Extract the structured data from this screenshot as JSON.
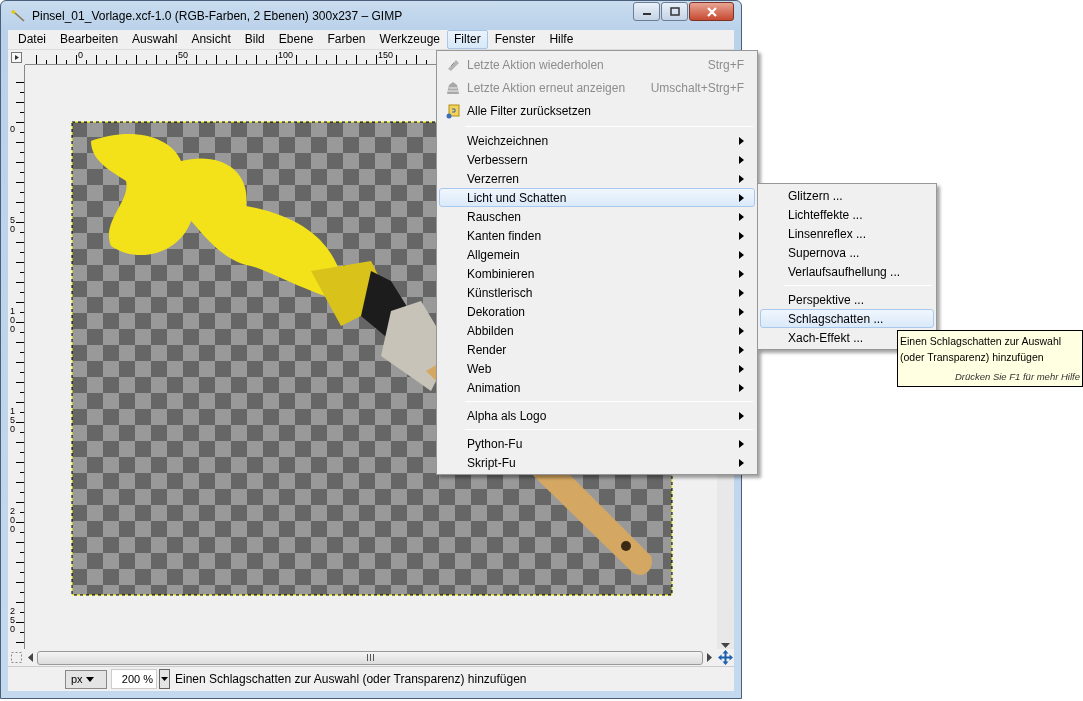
{
  "window": {
    "title": "Pinsel_01_Vorlage.xcf-1.0 (RGB-Farben, 2 Ebenen) 300x237 – GIMP"
  },
  "menubar": [
    {
      "label": "Datei",
      "selected": false
    },
    {
      "label": "Bearbeiten",
      "selected": false
    },
    {
      "label": "Auswahl",
      "selected": false
    },
    {
      "label": "Ansicht",
      "selected": false
    },
    {
      "label": "Bild",
      "selected": false
    },
    {
      "label": "Ebene",
      "selected": false
    },
    {
      "label": "Farben",
      "selected": false
    },
    {
      "label": "Werkzeuge",
      "selected": false
    },
    {
      "label": "Filter",
      "selected": true
    },
    {
      "label": "Fenster",
      "selected": false
    },
    {
      "label": "Hilfe",
      "selected": false
    }
  ],
  "rulers": {
    "horizontal": [
      "0",
      "50",
      "100",
      "150"
    ],
    "vertical": [
      "0",
      "50",
      "100",
      "150",
      "200",
      "250"
    ]
  },
  "filter_menu": {
    "items": [
      {
        "kind": "action",
        "label": "Letzte Aktion wiederholen",
        "shortcut": "Strg+F",
        "disabled": true
      },
      {
        "kind": "action",
        "label": "Letzte Aktion erneut anzeigen",
        "shortcut": "Umschalt+Strg+F",
        "disabled": true
      },
      {
        "kind": "action",
        "label": "Alle Filter zurücksetzen",
        "disabled": false
      },
      {
        "kind": "separator"
      },
      {
        "kind": "submenu",
        "label": "Weichzeichnen",
        "selected": false
      },
      {
        "kind": "submenu",
        "label": "Verbessern",
        "selected": false
      },
      {
        "kind": "submenu",
        "label": "Verzerren",
        "selected": false
      },
      {
        "kind": "submenu",
        "label": "Licht und Schatten",
        "selected": true
      },
      {
        "kind": "submenu",
        "label": "Rauschen",
        "selected": false
      },
      {
        "kind": "submenu",
        "label": "Kanten finden",
        "selected": false
      },
      {
        "kind": "submenu",
        "label": "Allgemein",
        "selected": false
      },
      {
        "kind": "submenu",
        "label": "Kombinieren",
        "selected": false
      },
      {
        "kind": "submenu",
        "label": "Künstlerisch",
        "selected": false
      },
      {
        "kind": "submenu",
        "label": "Dekoration",
        "selected": false
      },
      {
        "kind": "submenu",
        "label": "Abbilden",
        "selected": false
      },
      {
        "kind": "submenu",
        "label": "Render",
        "selected": false
      },
      {
        "kind": "submenu",
        "label": "Web",
        "selected": false
      },
      {
        "kind": "submenu",
        "label": "Animation",
        "selected": false
      },
      {
        "kind": "separator"
      },
      {
        "kind": "submenu",
        "label": "Alpha als Logo",
        "selected": false
      },
      {
        "kind": "separator"
      },
      {
        "kind": "submenu",
        "label": "Python-Fu",
        "selected": false
      },
      {
        "kind": "submenu",
        "label": "Skript-Fu",
        "selected": false
      }
    ]
  },
  "submenu": {
    "items": [
      {
        "kind": "action",
        "label": "Glitzern ...",
        "selected": false
      },
      {
        "kind": "action",
        "label": "Lichteffekte ...",
        "selected": false
      },
      {
        "kind": "action",
        "label": "Linsenreflex ...",
        "selected": false
      },
      {
        "kind": "action",
        "label": "Supernova ...",
        "selected": false
      },
      {
        "kind": "action",
        "label": "Verlaufsaufhellung ...",
        "selected": false
      },
      {
        "kind": "separator"
      },
      {
        "kind": "action",
        "label": "Perspektive ...",
        "selected": false
      },
      {
        "kind": "action",
        "label": "Schlagschatten ...",
        "selected": true
      },
      {
        "kind": "action",
        "label": "Xach-Effekt ...",
        "selected": false
      }
    ]
  },
  "tooltip": {
    "text": "Einen Schlagschatten zur Auswahl (oder Transparenz) hinzufügen",
    "hint": "Drücken Sie F1 für mehr Hilfe"
  },
  "status_bar": {
    "unit": "px",
    "zoom": "200 %",
    "message": "Einen Schlagschatten zur Auswahl (oder Transparenz) hinzufügen"
  }
}
